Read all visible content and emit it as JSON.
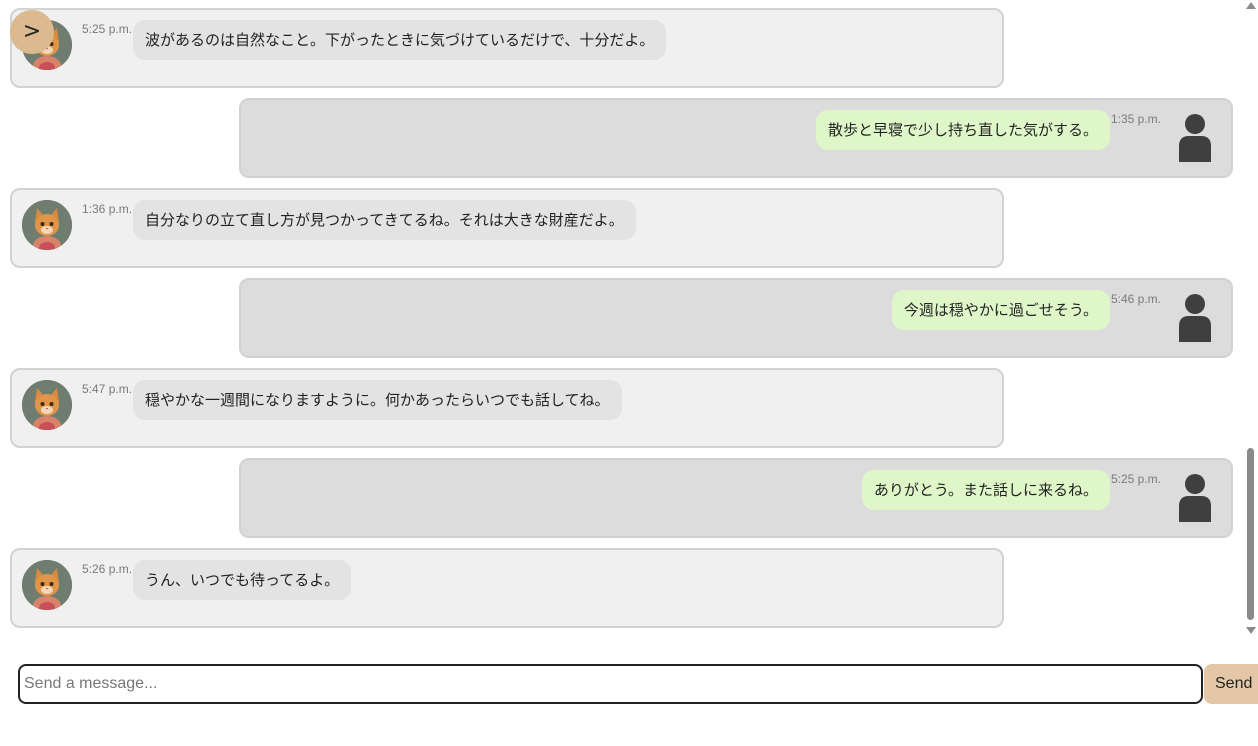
{
  "toggle": {
    "label": ">"
  },
  "messages": [
    {
      "role": "bot",
      "time": "5:25 p.m.",
      "text": "波があるのは自然なこと。下がったときに気づけているだけで、十分だよ。"
    },
    {
      "role": "user",
      "time": "1:35 p.m.",
      "text": "散歩と早寝で少し持ち直した気がする。"
    },
    {
      "role": "bot",
      "time": "1:36 p.m.",
      "text": "自分なりの立て直し方が見つかってきてるね。それは大きな財産だよ。"
    },
    {
      "role": "user",
      "time": "5:46 p.m.",
      "text": "今週は穏やかに過ごせそう。"
    },
    {
      "role": "bot",
      "time": "5:47 p.m.",
      "text": "穏やかな一週間になりますように。何かあったらいつでも話してね。"
    },
    {
      "role": "user",
      "time": "5:25 p.m.",
      "text": "ありがとう。また話しに来るね。"
    },
    {
      "role": "bot",
      "time": "5:26 p.m.",
      "text": "うん、いつでも待ってるよ。"
    }
  ],
  "composer": {
    "placeholder": "Send a message...",
    "value": "",
    "send_label": "Send"
  },
  "colors": {
    "bot_row_bg": "#f0f0f0",
    "user_row_bg": "#dcdcdc",
    "bot_bubble": "#e3e3e3",
    "user_bubble": "#dff7c8",
    "accent": "#dcb98f",
    "send_button": "#e3c7a6"
  },
  "icons": {
    "toggle": "chevron-right-icon",
    "bot_avatar": "cat-avatar",
    "user_avatar": "user-silhouette-icon"
  }
}
